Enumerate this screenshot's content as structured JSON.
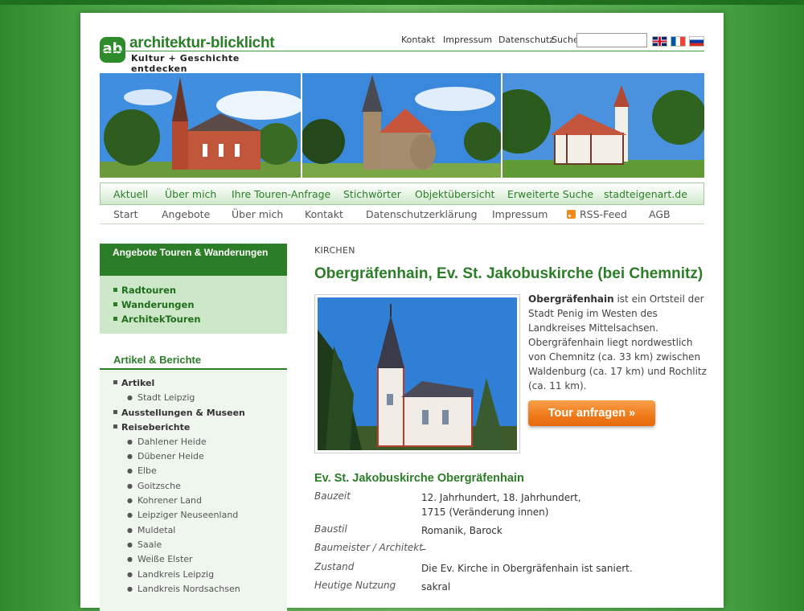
{
  "logo": {
    "mark": "ab",
    "name": "architektur-blicklicht",
    "tagline": "Kultur + Geschichte entdecken"
  },
  "toplinks": {
    "kontakt": "Kontakt",
    "impressum": "Impressum",
    "datenschutz": "Datenschutz",
    "suche": "Suche",
    "search_value": ""
  },
  "nav_primary": [
    "Aktuell",
    "Über mich",
    "Ihre Touren-Anfrage",
    "Stichwörter",
    "Objektübersicht",
    "Erweiterte Suche",
    "stadteigenart.de"
  ],
  "nav_secondary": [
    "Start",
    "Angebote",
    "Über mich",
    "Kontakt",
    "Datenschutzerklärung",
    "Impressum",
    "RSS-Feed",
    "AGB"
  ],
  "sidebar": {
    "box1_title": "Angebote Touren & Wanderungen",
    "box1_items": [
      "Radtouren",
      "Wanderungen",
      "ArchitekTouren"
    ],
    "box2_title": "Artikel & Berichte",
    "box2_items": [
      {
        "label": "Artikel",
        "level": 1
      },
      {
        "label": "Stadt Leipzig",
        "level": 2
      },
      {
        "label": "Ausstellungen & Museen",
        "level": 1
      },
      {
        "label": "Reiseberichte",
        "level": 1
      },
      {
        "label": "Dahlener Heide",
        "level": 2
      },
      {
        "label": "Dübener Heide",
        "level": 2
      },
      {
        "label": "Elbe",
        "level": 2
      },
      {
        "label": "Goitzsche",
        "level": 2
      },
      {
        "label": "Kohrener Land",
        "level": 2
      },
      {
        "label": "Leipziger Neuseenland",
        "level": 2
      },
      {
        "label": "Muldetal",
        "level": 2
      },
      {
        "label": "Saale",
        "level": 2
      },
      {
        "label": "Weiße Elster",
        "level": 2
      },
      {
        "label": "Landkreis Leipzig",
        "level": 2
      },
      {
        "label": "Landkreis Nordsachsen",
        "level": 2
      }
    ]
  },
  "main": {
    "category": "KIRCHEN",
    "title": "Obergräfenhain, Ev. St. Jakobuskirche (bei Chemnitz)",
    "intro_bold": "Obergräfenhain",
    "intro_rest": " ist ein Ortsteil der Stadt Penig im Westen des Landkreises Mittelsachsen. Obergräfenhain liegt nordwestlich von Chemnitz (ca. 33 km) zwischen Waldenburg (ca. 17 km) und Rochlitz (ca. 11 km).",
    "tour_button": "Tour anfragen »",
    "subtitle": "Ev. St. Jakobuskirche Obergräfenhain",
    "facts": [
      {
        "key": "Bauzeit",
        "value": "12. Jahrhundert, 18. Jahrhundert,",
        "value2": "1715 (Veränderung innen)"
      },
      {
        "key": "Baustil",
        "value": "Romanik, Barock"
      },
      {
        "key": "Baumeister / Architekt",
        "value": "–"
      },
      {
        "key": "Zustand",
        "value": "Die Ev. Kirche in Obergräfenhain ist saniert."
      },
      {
        "key": "Heutige Nutzung",
        "value": "sakral"
      }
    ]
  },
  "colors": {
    "brand_green": "#2b7d27",
    "accent_orange": "#ef7a19"
  }
}
